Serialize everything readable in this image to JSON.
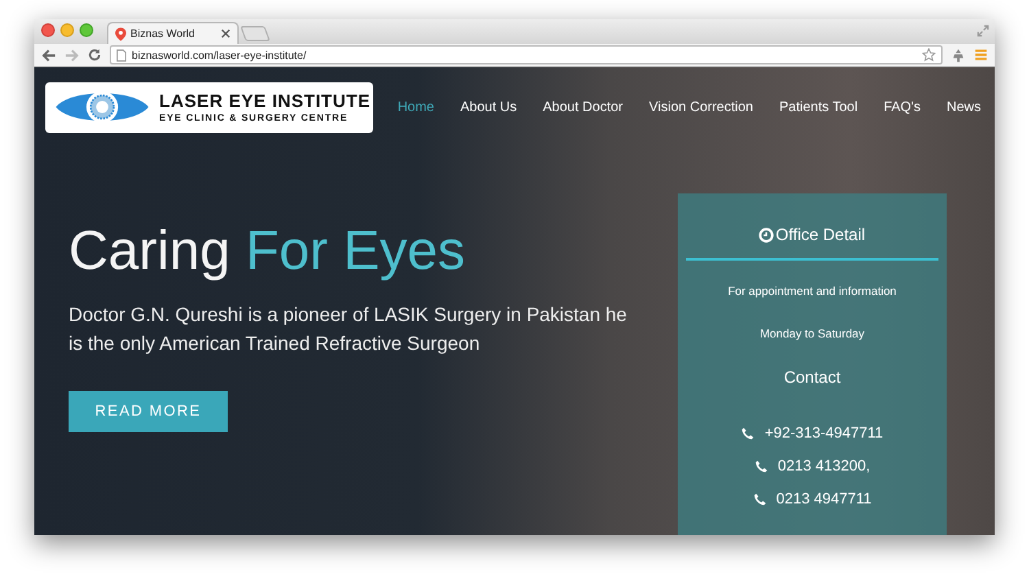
{
  "browser": {
    "tab_title": "Biznas World",
    "url": "biznasworld.com/laser-eye-institute/"
  },
  "logo": {
    "title": "LASER EYE INSTITUTE",
    "subtitle": "EYE CLINIC & SURGERY CENTRE"
  },
  "nav": [
    {
      "label": "Home",
      "selected": true
    },
    {
      "label": "About Us",
      "selected": false
    },
    {
      "label": "About Doctor",
      "selected": false
    },
    {
      "label": "Vision Correction",
      "selected": false
    },
    {
      "label": "Patients Tool",
      "selected": false
    },
    {
      "label": "FAQ's",
      "selected": false
    },
    {
      "label": "News",
      "selected": false
    }
  ],
  "hero": {
    "title_lead": "Caring",
    "title_highlight": "For Eyes",
    "description": "Doctor G.N. Qureshi is a pioneer of LASIK Surgery in Pakistan he is the only American Trained Refractive Surgeon",
    "button": "READ MORE"
  },
  "office": {
    "title": "Office Detail",
    "lines": [
      "For appointment and information",
      "Monday to Saturday"
    ],
    "contact_title": "Contact",
    "phones": [
      "+92-313-4947711",
      "0213 413200,",
      "0213 4947711"
    ]
  }
}
